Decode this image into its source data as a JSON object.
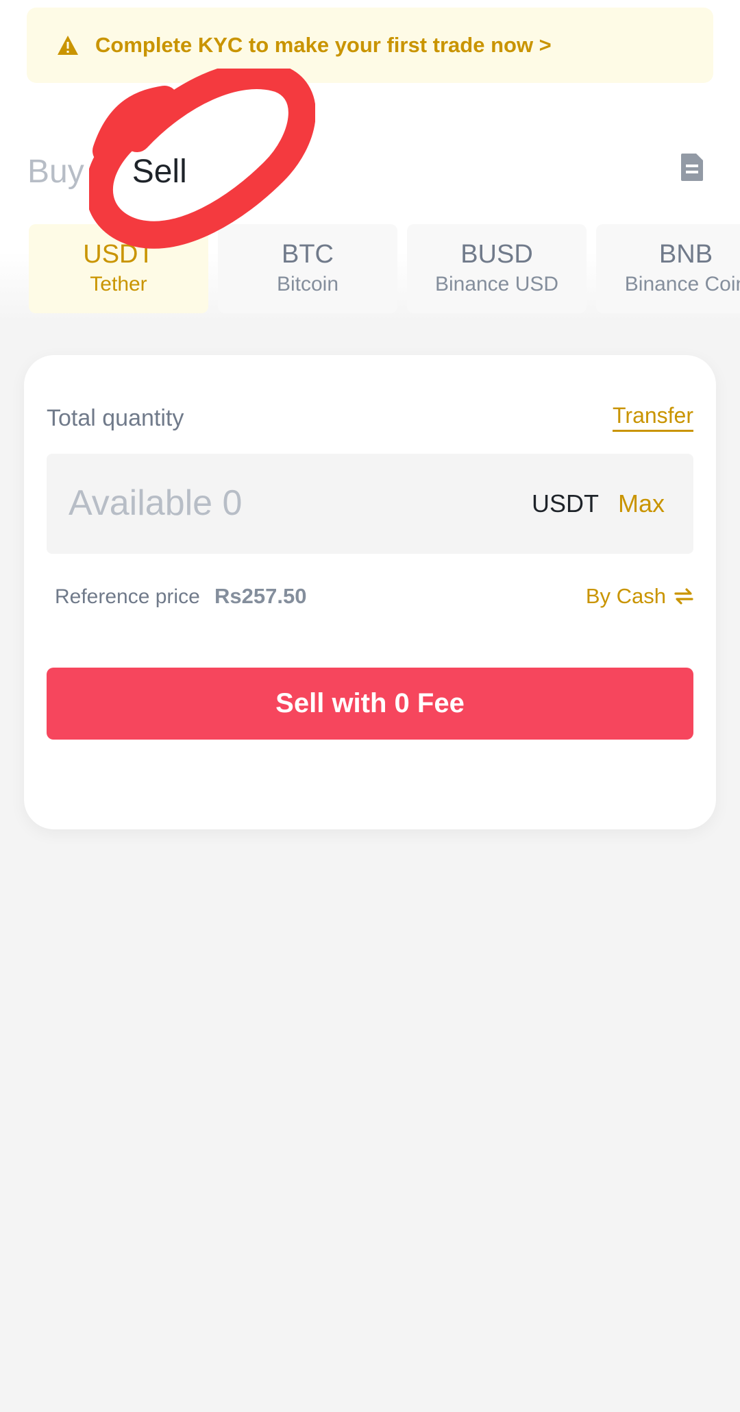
{
  "kyc_banner": {
    "text": "Complete KYC to make your first trade now >",
    "icon": "warning-icon"
  },
  "tabs": {
    "buy": "Buy",
    "sell": "Sell",
    "active": "sell"
  },
  "orders_icon": "document-icon",
  "coins": [
    {
      "symbol": "USDT",
      "name": "Tether",
      "active": true
    },
    {
      "symbol": "BTC",
      "name": "Bitcoin",
      "active": false
    },
    {
      "symbol": "BUSD",
      "name": "Binance USD",
      "active": false
    },
    {
      "symbol": "BNB",
      "name": "Binance Coin",
      "active": false
    }
  ],
  "trade": {
    "quantity_label": "Total quantity",
    "transfer_label": "Transfer",
    "quantity_placeholder": "Available 0",
    "unit": "USDT",
    "max_label": "Max",
    "reference_label": "Reference price",
    "reference_value": "Rs257.50",
    "payment_method": "By Cash",
    "submit_label": "Sell with 0 Fee"
  },
  "colors": {
    "accent": "#c99400",
    "sell": "#f6465d",
    "banner_bg": "#fefbe6",
    "annotation": "#f43a3f"
  }
}
